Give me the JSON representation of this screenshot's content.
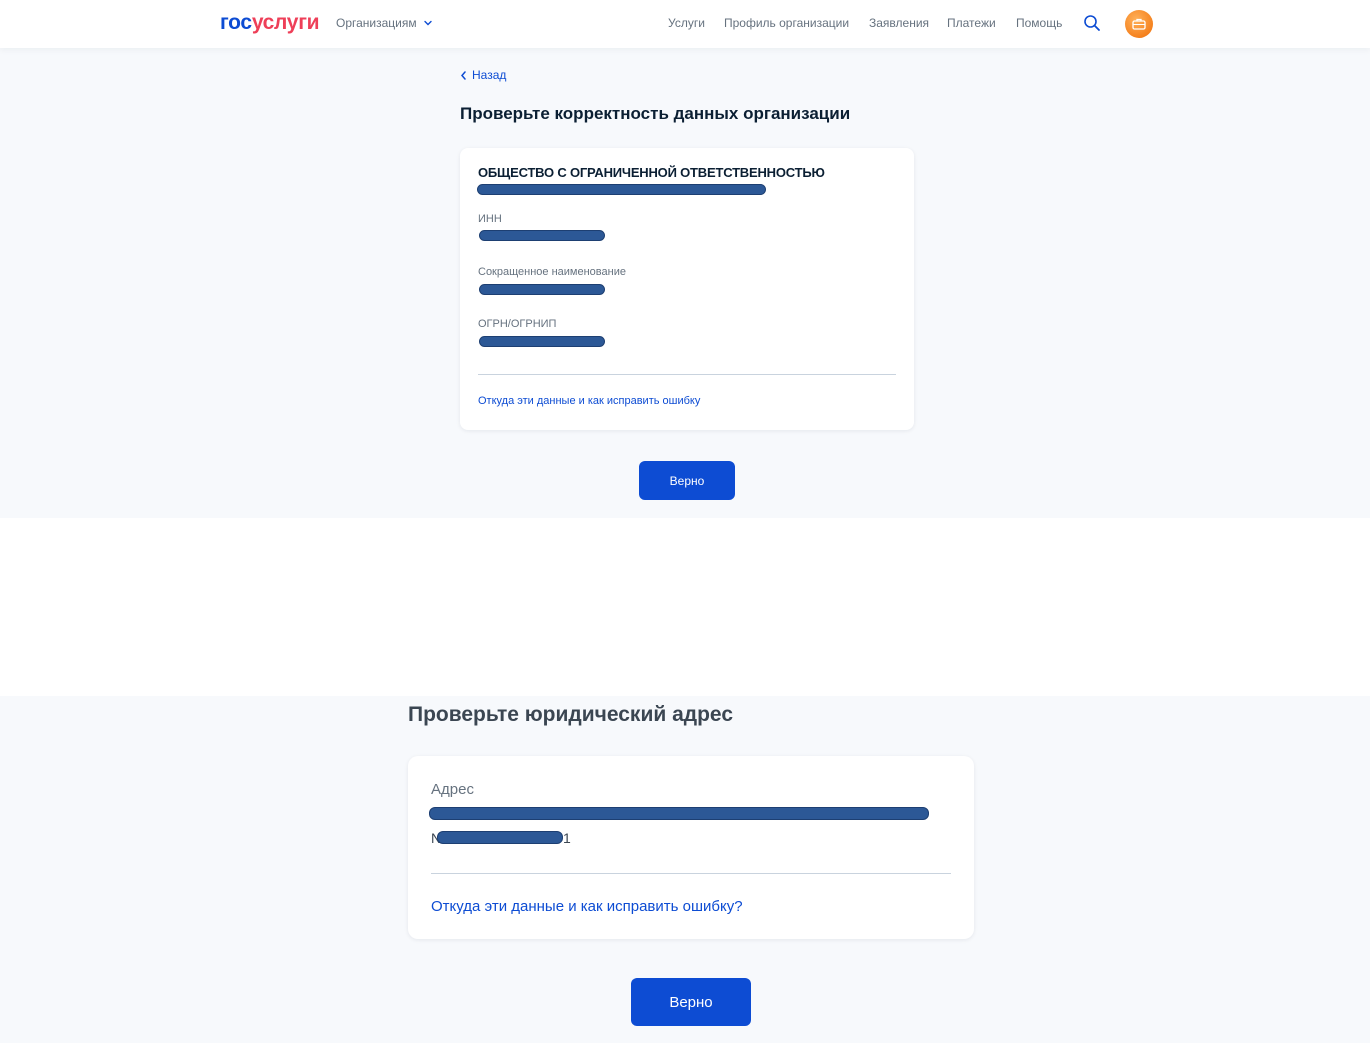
{
  "header": {
    "logo_part1": "гос",
    "logo_part2": "услуги",
    "org_menu_label": "Организациям",
    "nav_items": [
      "Услуги",
      "Профиль организации",
      "Заявления",
      "Платежи",
      "Помощь"
    ],
    "search_icon": "search-icon",
    "avatar_icon": "briefcase-icon"
  },
  "org_check": {
    "back_label": "Назад",
    "title": "Проверьте корректность данных организации",
    "org_type": "ОБЩЕСТВО С ОГРАНИЧЕННОЙ ОТВЕТСТВЕННОСТЬЮ",
    "fields": [
      {
        "label": "ИНН"
      },
      {
        "label": "Сокращенное наименование"
      },
      {
        "label": "ОГРН/ОГРНИП"
      }
    ],
    "help_link": "Откуда эти данные и как исправить ошибку",
    "confirm_button": "Верно"
  },
  "address_check": {
    "title": "Проверьте юридический адрес",
    "address_label": "Адрес",
    "address_line2_start": "N",
    "address_line2_end": "1",
    "help_link": "Откуда эти данные и как исправить ошибку?",
    "confirm_button": "Верно"
  },
  "colors": {
    "brand_blue": "#0d4cd3",
    "brand_red": "#ee3f58",
    "redaction": "#2c5896",
    "page_bg": "#f7f9fc"
  }
}
